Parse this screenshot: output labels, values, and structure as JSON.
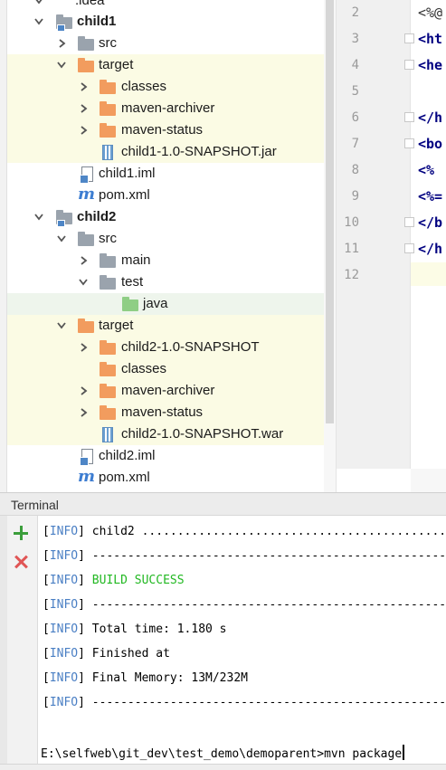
{
  "tree": {
    "rows": [
      {
        "label": ".idea"
      },
      {
        "label": "child1"
      },
      {
        "label": "src"
      },
      {
        "label": "target"
      },
      {
        "label": "classes"
      },
      {
        "label": "maven-archiver"
      },
      {
        "label": "maven-status"
      },
      {
        "label": "child1-1.0-SNAPSHOT.jar"
      },
      {
        "label": "child1.iml"
      },
      {
        "label": "pom.xml"
      },
      {
        "label": "child2"
      },
      {
        "label": "src"
      },
      {
        "label": "main"
      },
      {
        "label": "test"
      },
      {
        "label": "java"
      },
      {
        "label": "target"
      },
      {
        "label": "child2-1.0-SNAPSHOT"
      },
      {
        "label": "classes"
      },
      {
        "label": "maven-archiver"
      },
      {
        "label": "maven-status"
      },
      {
        "label": "child2-1.0-SNAPSHOT.war"
      },
      {
        "label": "child2.iml"
      },
      {
        "label": "pom.xml"
      }
    ]
  },
  "editor": {
    "line_numbers": [
      "2",
      "3",
      "4",
      "5",
      "6",
      "7",
      "8",
      "9",
      "10",
      "11",
      "12"
    ],
    "code_lines": [
      "<%@",
      "<ht",
      "<he",
      "",
      "</h",
      "<bo",
      "<%",
      "<%=",
      "</b",
      "</h",
      ""
    ]
  },
  "terminal": {
    "title": "Terminal",
    "tag": "[INFO]",
    "lines": [
      "child2 ................................................",
      "------------------------------------------------------------",
      "BUILD SUCCESS",
      "------------------------------------------------------------",
      "Total time: 1.180 s",
      "Finished at",
      "Final Memory: 13M/232M",
      "------------------------------------------------------------"
    ],
    "prompt": "E:\\selfweb\\git_dev\\test_demo\\demoparent>mvn package"
  },
  "colors": {
    "info": "#4a7fc4",
    "success": "#22b822",
    "target_highlight": "#fbfbe4",
    "folder": "#f29c5e"
  }
}
